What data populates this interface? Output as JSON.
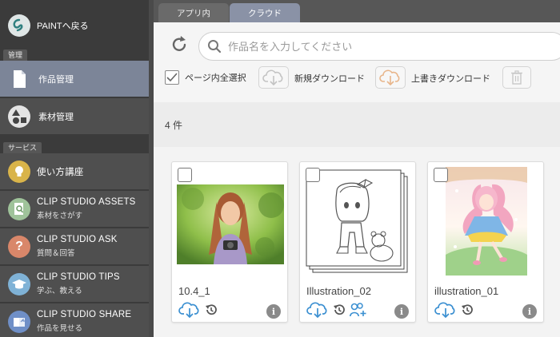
{
  "sidebar": {
    "back_label": "PAINTへ戻る",
    "section_manage": "管理",
    "manage_items": [
      {
        "label": "作品管理",
        "icon": "document-icon"
      },
      {
        "label": "素材管理",
        "icon": "shapes-icon"
      }
    ],
    "section_services": "サービス",
    "services": [
      {
        "title": "使い方講座",
        "subtitle": "",
        "icon": "lightbulb-icon",
        "color": "#d9b44a"
      },
      {
        "title": "CLIP STUDIO ASSETS",
        "subtitle": "素材をさがす",
        "icon": "magnifier-document-icon",
        "color": "#9fc39a"
      },
      {
        "title": "CLIP STUDIO ASK",
        "subtitle": "質問＆回答",
        "icon": "question-icon",
        "color": "#d9876a"
      },
      {
        "title": "CLIP STUDIO TIPS",
        "subtitle": "学ぶ、教える",
        "icon": "graduation-cap-icon",
        "color": "#7fb2d6"
      },
      {
        "title": "CLIP STUDIO SHARE",
        "subtitle": "作品を見せる",
        "icon": "book-share-icon",
        "color": "#6f8fc7"
      }
    ]
  },
  "tabs": {
    "in_app": "アプリ内",
    "cloud": "クラウド"
  },
  "toolbar": {
    "search_placeholder": "作品名を入力してください",
    "select_all_label": "ページ内全選択",
    "new_download_label": "新規ダウンロード",
    "overwrite_download_label": "上書きダウンロード"
  },
  "count_label": "4 件",
  "works": [
    {
      "name": "10.4_1"
    },
    {
      "name": "Illustration_02"
    },
    {
      "name": "illustration_01"
    }
  ],
  "colors": {
    "accent": "#7c8598",
    "cloud_icon": "#3a8fd1",
    "orange_cloud": "#e8a46b"
  }
}
